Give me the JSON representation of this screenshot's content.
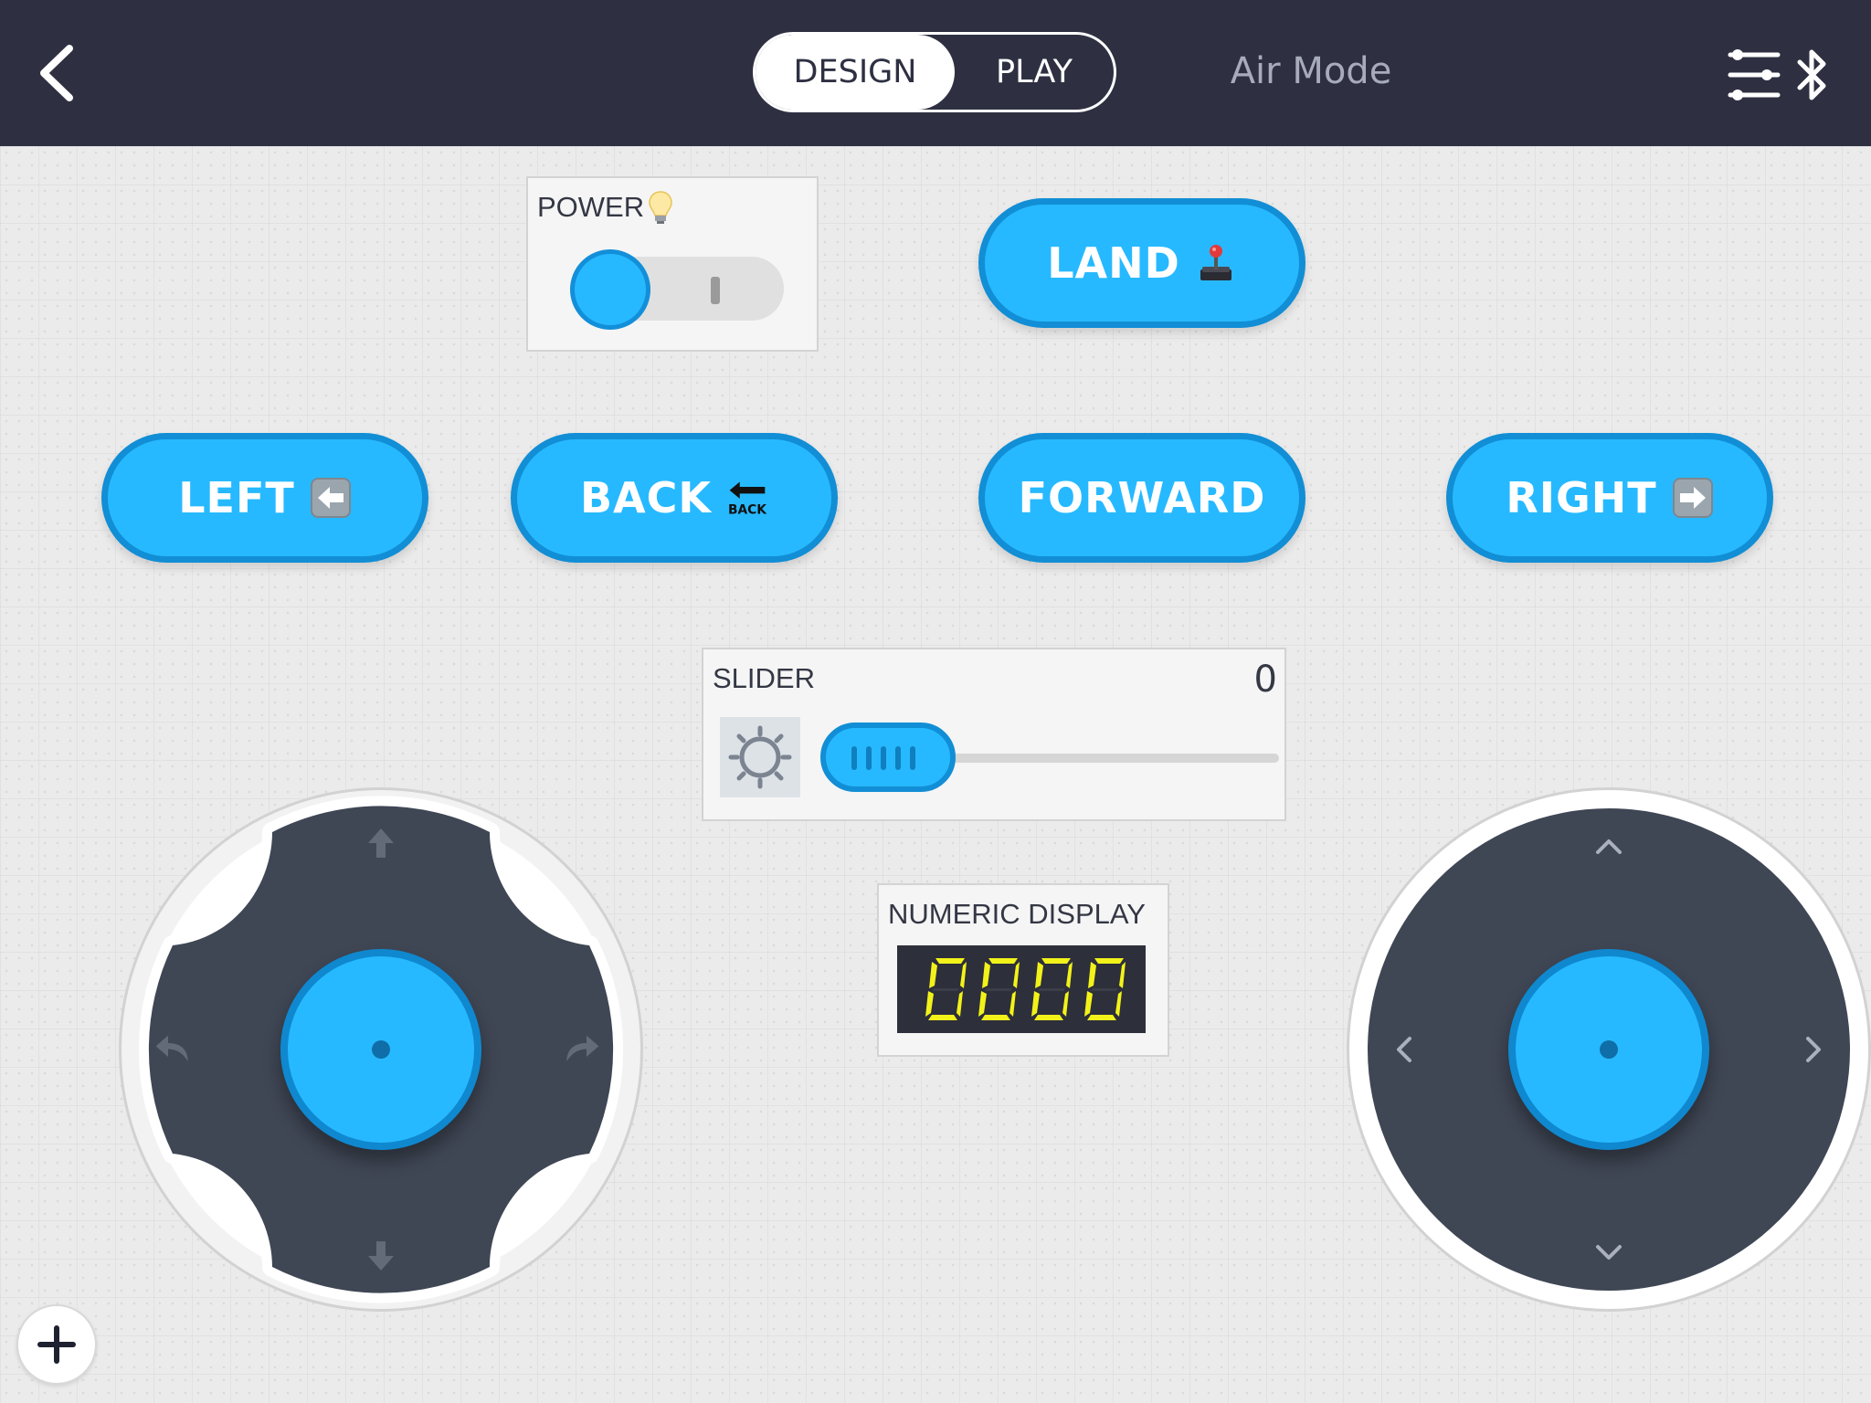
{
  "header": {
    "back_icon": "chevron-left-icon",
    "tabs": [
      {
        "label": "DESIGN",
        "selected": true
      },
      {
        "label": "PLAY",
        "selected": false
      }
    ],
    "mode_label": "Air Mode",
    "settings_icon": "sliders-icon",
    "bluetooth_icon": "bluetooth-icon"
  },
  "power_switch": {
    "title": "POWER",
    "icon": "light-bulb-icon",
    "state": "off"
  },
  "buttons": {
    "land": {
      "label": "LAND",
      "icon": "joystick-icon"
    },
    "left": {
      "label": "LEFT",
      "icon": "left-arrow-icon"
    },
    "back": {
      "label": "BACK",
      "icon": "back-arrow-icon",
      "icon_text": "BACK"
    },
    "forward": {
      "label": "FORWARD"
    },
    "right": {
      "label": "RIGHT",
      "icon": "right-arrow-icon"
    }
  },
  "slider": {
    "title": "SLIDER",
    "value": "0",
    "icon": "sun-icon"
  },
  "numeric_display": {
    "title": "NUMERIC DISPLAY",
    "value": "0000"
  },
  "joystick_left": {
    "icons": [
      "arrow-up-icon",
      "arrow-down-icon",
      "turn-left-icon",
      "turn-right-icon"
    ]
  },
  "joystick_right": {
    "icons": [
      "chevron-up-icon",
      "chevron-down-icon",
      "chevron-left-icon",
      "chevron-right-icon"
    ]
  },
  "add_button": {
    "icon": "plus-icon"
  },
  "colors": {
    "topbar": "#2e3042",
    "accent": "#27b9ff",
    "accent_border": "#118ed5",
    "joystick_dark": "#3f4654",
    "lcd_digit": "#f2f21a"
  }
}
